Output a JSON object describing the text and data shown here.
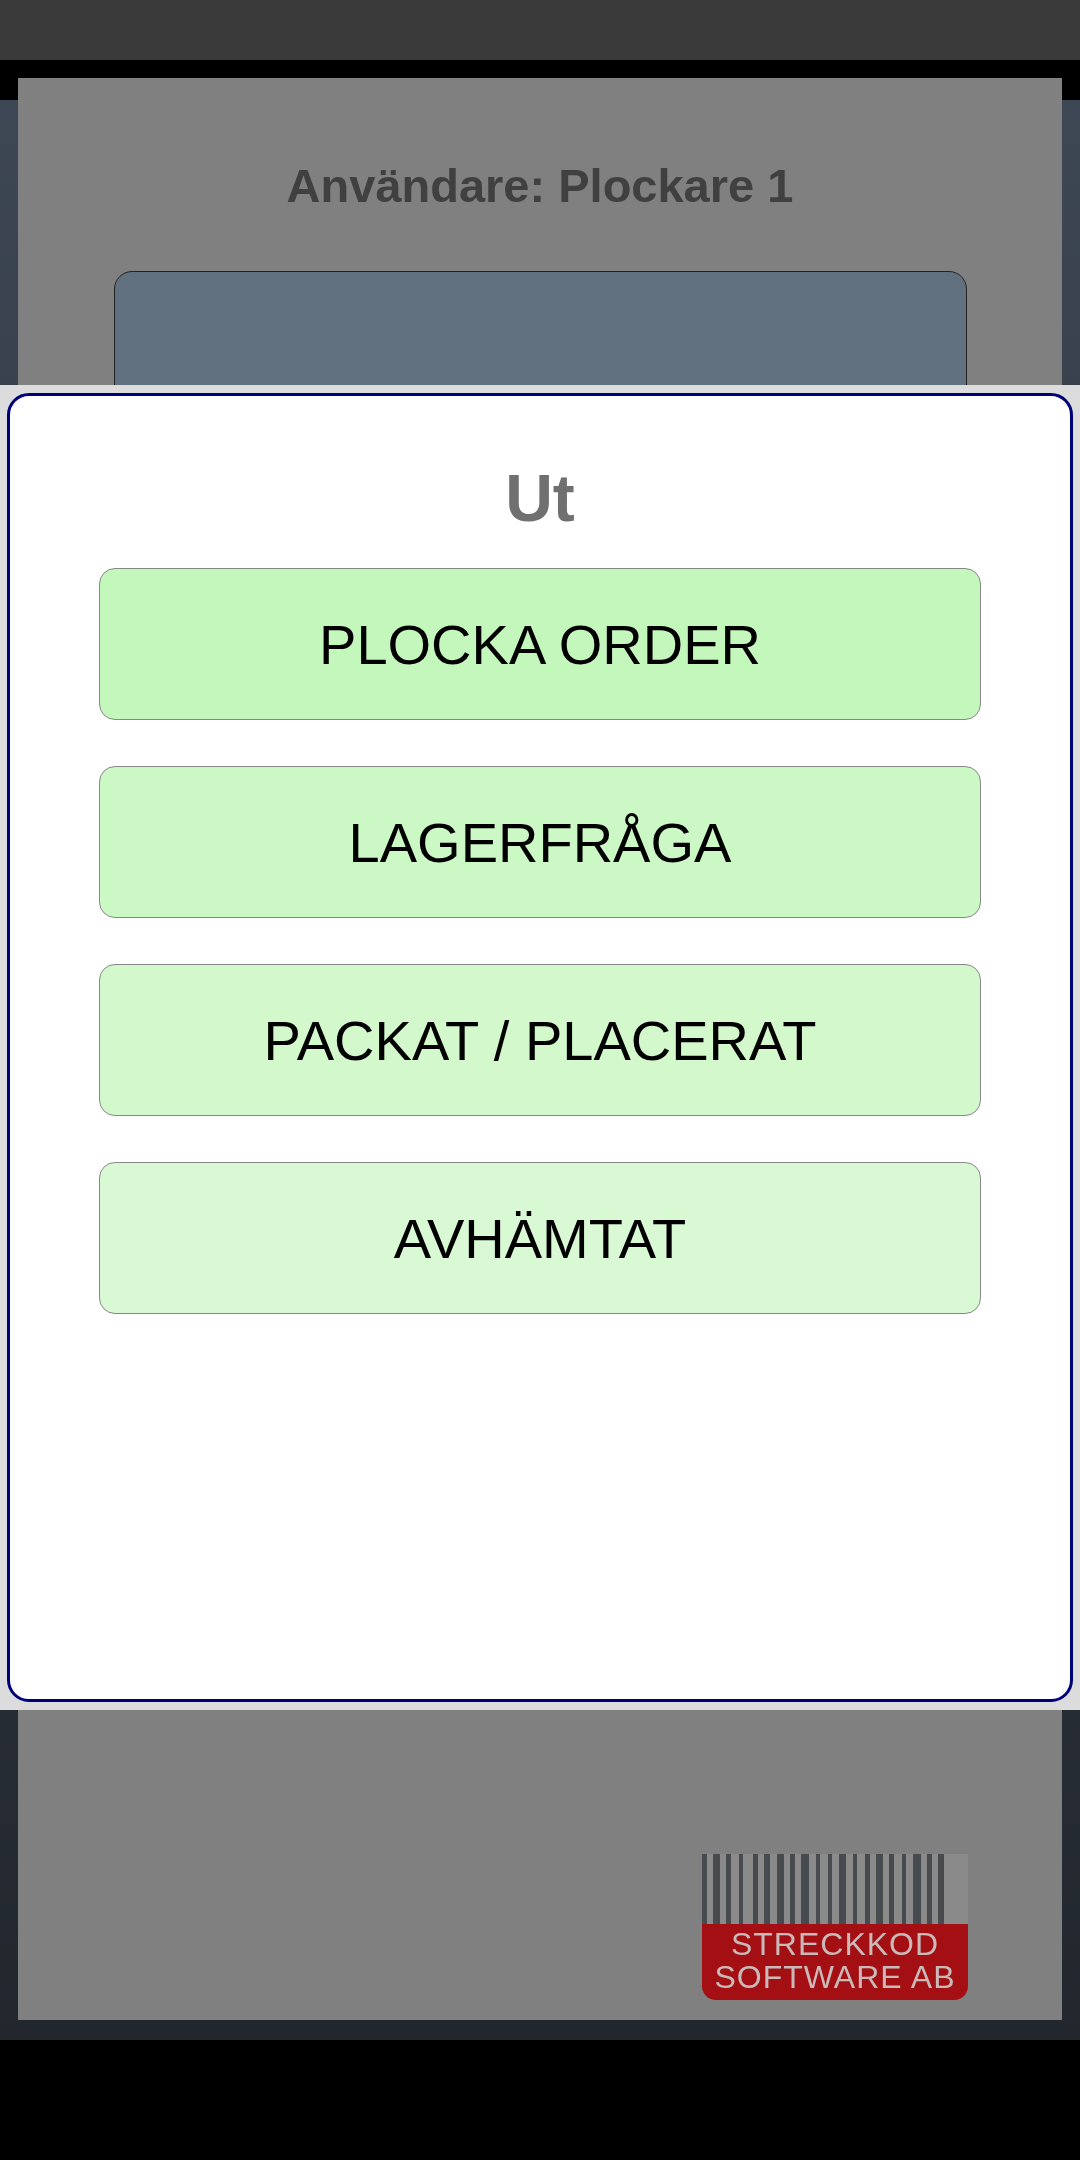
{
  "background": {
    "title": "Användare: Plockare 1"
  },
  "dialog": {
    "title": "Ut",
    "buttons": [
      {
        "label": "PLOCKA ORDER",
        "color": "#c4f7bc"
      },
      {
        "label": "LAGERFRÅGA",
        "color": "#cbf8c4"
      },
      {
        "label": "PACKAT / PLACERAT",
        "color": "#d2f8cc"
      },
      {
        "label": "AVHÄMTAT",
        "color": "#d9f9d4"
      }
    ]
  },
  "logo": {
    "lines": [
      "STRECKKOD",
      "SOFTWARE AB"
    ]
  }
}
